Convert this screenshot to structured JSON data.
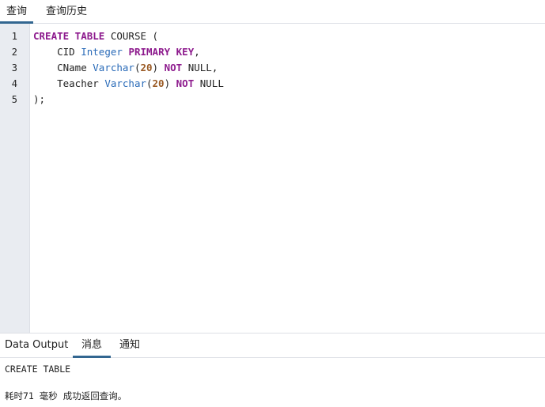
{
  "top_tabs": {
    "query": "查询",
    "history": "查询历史",
    "active": "query"
  },
  "editor": {
    "line_numbers": [
      "1",
      "2",
      "3",
      "4",
      "5"
    ],
    "lines": [
      [
        {
          "text": "CREATE TABLE",
          "kind": "keyword"
        },
        {
          "text": " COURSE (",
          "kind": "plain"
        }
      ],
      [
        {
          "text": "    CID ",
          "kind": "plain"
        },
        {
          "text": "Integer",
          "kind": "type"
        },
        {
          "text": " ",
          "kind": "plain"
        },
        {
          "text": "PRIMARY KEY",
          "kind": "keyword"
        },
        {
          "text": ",",
          "kind": "plain"
        }
      ],
      [
        {
          "text": "    CName ",
          "kind": "plain"
        },
        {
          "text": "Varchar",
          "kind": "type"
        },
        {
          "text": "(",
          "kind": "plain"
        },
        {
          "text": "20",
          "kind": "number"
        },
        {
          "text": ") ",
          "kind": "plain"
        },
        {
          "text": "NOT",
          "kind": "keyword"
        },
        {
          "text": " NULL,",
          "kind": "plain"
        }
      ],
      [
        {
          "text": "    Teacher ",
          "kind": "plain"
        },
        {
          "text": "Varchar",
          "kind": "type"
        },
        {
          "text": "(",
          "kind": "plain"
        },
        {
          "text": "20",
          "kind": "number"
        },
        {
          "text": ") ",
          "kind": "plain"
        },
        {
          "text": "NOT",
          "kind": "keyword"
        },
        {
          "text": " NULL",
          "kind": "plain"
        }
      ],
      [
        {
          "text": ");",
          "kind": "plain"
        }
      ]
    ]
  },
  "bottom_tabs": {
    "data_output": "Data Output",
    "messages": "消息",
    "notices": "通知",
    "active": "messages"
  },
  "messages": {
    "line1": "CREATE TABLE",
    "line2": "耗时71 毫秒 成功返回查询。"
  },
  "colors": {
    "accent": "#326690",
    "keyword": "#8d1a8d",
    "type": "#2a6bb8",
    "number": "#9a5a24",
    "gutter": "#e9ecf1"
  }
}
